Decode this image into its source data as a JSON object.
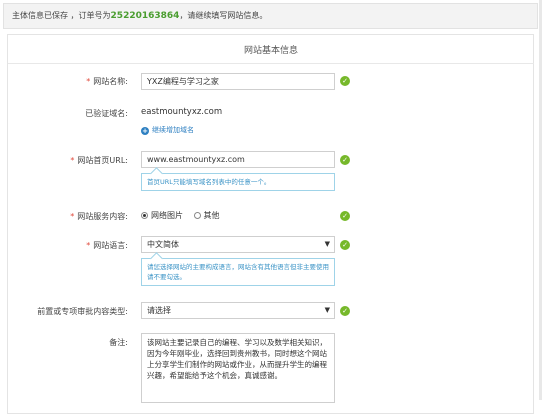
{
  "notice": {
    "prefix": "主体信息已保存 ，订单号为",
    "order_no": "25220163864",
    "suffix": "，请继续填写网站信息。"
  },
  "panel_title": "网站基本信息",
  "site_name": {
    "label": "网站名称:",
    "value": "YXZ编程与学习之家"
  },
  "verified_domain": {
    "label": "已验证域名:",
    "value": "eastmountyxz.com",
    "add_label": "继续增加域名"
  },
  "homepage": {
    "label": "网站首页URL:",
    "value": "www.eastmountyxz.com",
    "tip": "首页URL只能填写域名列表中的任意一个。"
  },
  "service": {
    "label": "网站服务内容:",
    "options": [
      "网络图片",
      "其他"
    ],
    "selected": "网络图片"
  },
  "language": {
    "label": "网站语言:",
    "value": "中文简体",
    "tip": "请您选择网站的主要构成语言，网站含有其他语言但非主要使用请不要勾选。"
  },
  "approval": {
    "label": "前置或专项审批内容类型:",
    "value": "请选择"
  },
  "remark": {
    "label": "备注:",
    "value": "该网站主要记录自己的编程、学习以及数学相关知识，因为今年刚毕业，选择回到贵州教书，同时想这个网站上分享学生们制作的网站或作业，从而提升学生的编程兴趣，希望能给予这个机会，真诚感谢。"
  },
  "colors": {
    "ok": "#76b82a",
    "order": "#4a9d2f",
    "required": "#e04a3c",
    "link": "#2d7fc1",
    "tip_border": "#9fd3e8"
  }
}
